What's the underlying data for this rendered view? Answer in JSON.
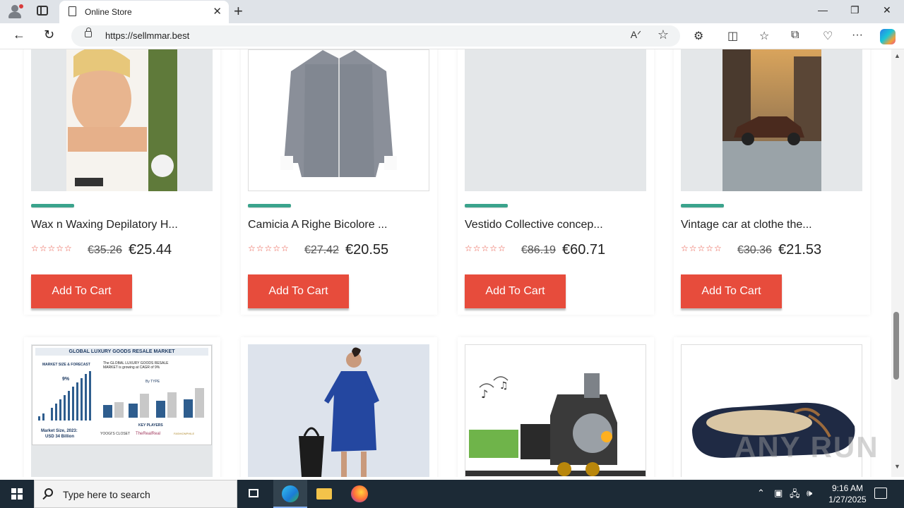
{
  "browser": {
    "tab_title": "Online Store",
    "tab_close": "✕",
    "new_tab": "+",
    "url": "https://sellmmar.best",
    "read_aloud": "Aᐟ",
    "favorite": "☆",
    "window": {
      "minimize": "—",
      "restore": "❐",
      "close": "✕"
    },
    "nav": {
      "back": "←",
      "reload": "↻"
    },
    "tools": {
      "extensions": "⚙",
      "split": "◫",
      "favorites": "☆",
      "collections": "⧉",
      "performance": "♡",
      "more": "···"
    }
  },
  "products": [
    {
      "name": "Wax n Waxing Depilatory H...",
      "old_price": "€35.26",
      "price": "€25.44",
      "stars": "☆☆☆☆☆",
      "button": "Add To Cart"
    },
    {
      "name": "Camicia A Righe Bicolore ...",
      "old_price": "€27.42",
      "price": "€20.55",
      "stars": "☆☆☆☆☆",
      "button": "Add To Cart"
    },
    {
      "name": "Vestido Collective concep...",
      "old_price": "€86.19",
      "price": "€60.71",
      "stars": "☆☆☆☆☆",
      "button": "Add To Cart"
    },
    {
      "name": "Vintage car at clothe the...",
      "old_price": "€30.36",
      "price": "€21.53",
      "stars": "☆☆☆☆☆",
      "button": "Add To Cart"
    }
  ],
  "second_row": {
    "market_infographic": {
      "title": "GLOBAL LUXURY GOODS RESALE MARKET",
      "subtitle": "MARKET SIZE & FORECAST",
      "blurb": "The GLOBAL LUXURY GOODS RESALE MARKET is growing at CAGR of 9%",
      "cagr": "9%",
      "by_type": "By TYPE",
      "key_players": "KEY PLAYERS",
      "market_size_label": "Market Size, 2023:",
      "market_size_value": "USD 34 Billion",
      "players": [
        "YOOGI'S CLOSET",
        "TheRealReal",
        "FASHIONPHILE"
      ]
    }
  },
  "watermark": "ANY RUN",
  "taskbar": {
    "search_placeholder": "Type here to search",
    "time": "9:16 AM",
    "date": "1/27/2025"
  },
  "colors": {
    "accent": "#e74c3c",
    "progress": "#3aa38c",
    "taskbar": "#1c2a36"
  }
}
